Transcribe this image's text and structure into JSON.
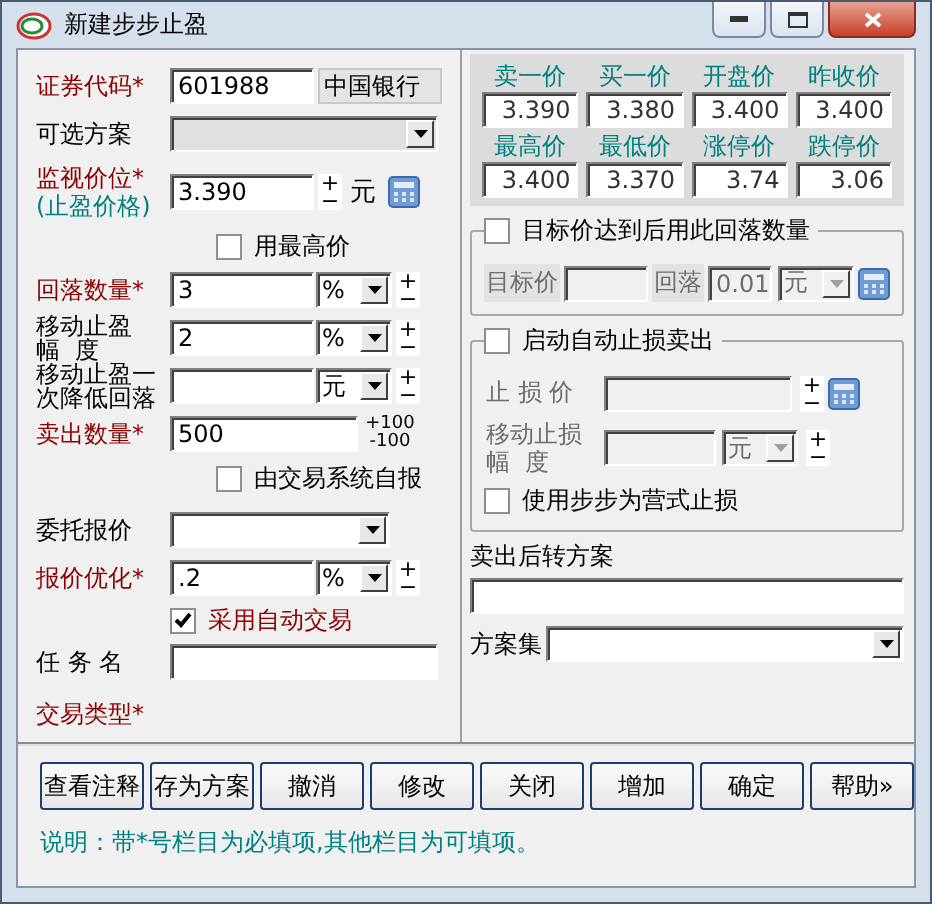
{
  "window": {
    "title": "新建步步止盈"
  },
  "form": [
    {
      "kind": "code",
      "label": "证券代码*",
      "required": true,
      "value": "601988",
      "readout": "中国银行"
    },
    {
      "kind": "select",
      "label": "可选方案",
      "required": false,
      "disabled": true
    },
    {
      "kind": "input",
      "label": "监视价位*",
      "sublabel": "(止盈价格)",
      "required": true,
      "value": "3.390",
      "stepper": [
        "+",
        "−"
      ],
      "unit": {
        "text": "元",
        "dropdown": false
      },
      "calculator": true
    },
    {
      "kind": "checkbox",
      "label": "用最高价",
      "checked": false,
      "highlight": false
    },
    {
      "kind": "input",
      "label": "回落数量*",
      "required": true,
      "value": "3",
      "unit": {
        "text": "%",
        "dropdown": true
      },
      "stepper": [
        "+",
        "−"
      ]
    },
    {
      "kind": "input",
      "label": "移动止盈",
      "label_2": "幅  度",
      "required": false,
      "value": "2",
      "unit": {
        "text": "%",
        "dropdown": true
      },
      "stepper": [
        "+",
        "−"
      ]
    },
    {
      "kind": "input",
      "label": "移动止盈一",
      "label_2": "次降低回落",
      "required": false,
      "unit": {
        "text": "元",
        "dropdown": true
      },
      "stepper": [
        "+",
        "−"
      ]
    },
    {
      "kind": "input",
      "label": "卖出数量*",
      "required": true,
      "value": "500",
      "stepper": [
        "+100",
        "-100"
      ]
    },
    {
      "kind": "checkbox",
      "label": "由交易系统自报",
      "checked": false,
      "highlight": false
    },
    {
      "kind": "select",
      "label": "委托报价",
      "required": false,
      "disabled": false
    },
    {
      "kind": "input",
      "label": "报价优化*",
      "required": true,
      "value": ".2",
      "unit": {
        "text": "%",
        "dropdown": true
      },
      "stepper": [
        "+",
        "−"
      ]
    },
    {
      "kind": "checkbox",
      "label": "采用自动交易",
      "checked": true,
      "highlight": true
    },
    {
      "kind": "text",
      "label": "任 务 名",
      "required": false
    },
    {
      "kind": "label",
      "label": "交易类型*",
      "required": true
    }
  ],
  "quotes": [
    {
      "label": "卖一价",
      "value": "3.390"
    },
    {
      "label": "买一价",
      "value": "3.380"
    },
    {
      "label": "开盘价",
      "value": "3.400"
    },
    {
      "label": "昨收价",
      "value": "3.400"
    },
    {
      "label": "最高价",
      "value": "3.400"
    },
    {
      "label": "最低价",
      "value": "3.370"
    },
    {
      "label": "涨停价",
      "value": "3.74"
    },
    {
      "label": "跌停价",
      "value": "3.06"
    }
  ],
  "target_group": {
    "label": "目标价达到后用此回落数量",
    "checked": false,
    "disabled": true,
    "target_label": "目标价",
    "fallback_label": "回落",
    "fallback_value": "0.01",
    "unit": "元"
  },
  "stop_group": {
    "label": "启动自动止损卖出",
    "checked": false,
    "disabled": true,
    "stop_label": "止 损 价",
    "stepper": [
      "+",
      "−"
    ],
    "move_label": "移动止损",
    "move_label_2": "幅  度",
    "unit": "元",
    "move_stepper": [
      "+",
      "−"
    ],
    "step_option": {
      "label": "使用步步为营式止损",
      "checked": false
    }
  },
  "after_sale": {
    "label": "卖出后转方案"
  },
  "plan_set": {
    "label": "方案集"
  },
  "buttons": [
    "查看注释",
    "存为方案",
    "撤消",
    "修改",
    "关闭",
    "增加",
    "确定",
    "帮助»"
  ],
  "note": "说明：带*号栏目为必填项,其他栏目为可填项。"
}
